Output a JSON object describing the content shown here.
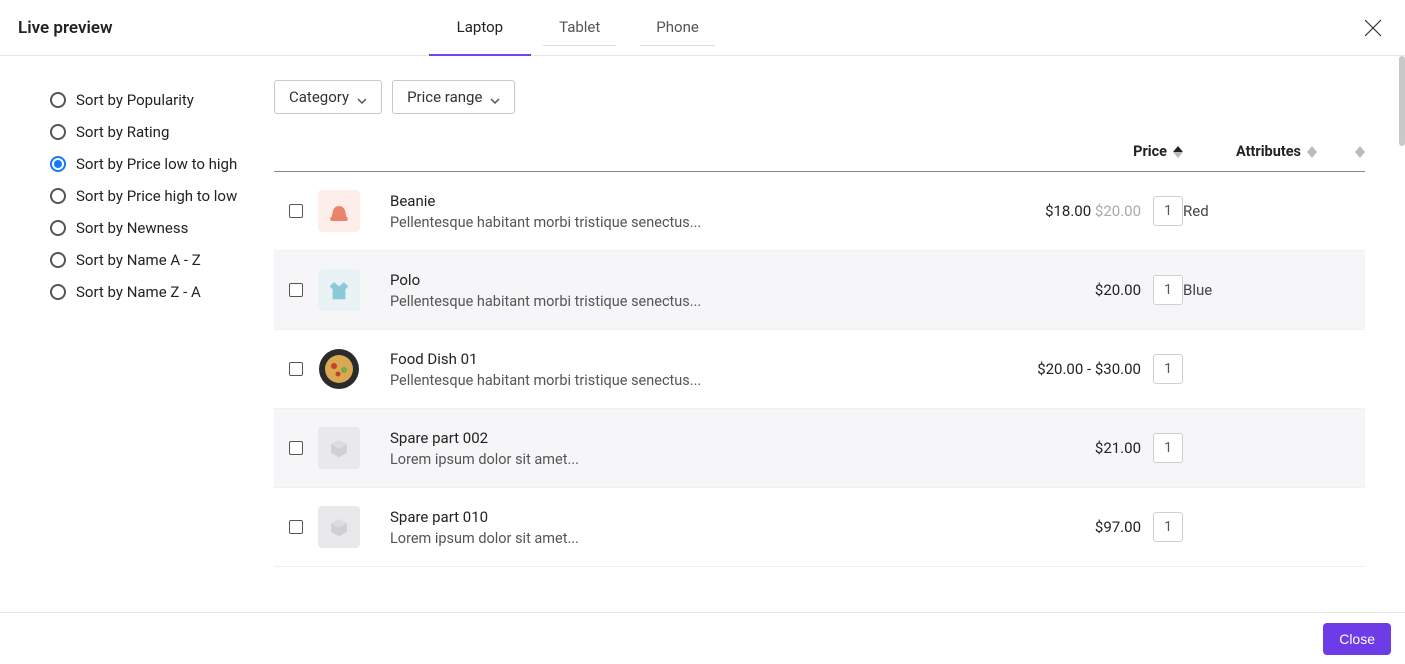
{
  "header": {
    "title": "Live preview",
    "tabs": [
      {
        "label": "Laptop",
        "active": true
      },
      {
        "label": "Tablet",
        "active": false
      },
      {
        "label": "Phone",
        "active": false
      }
    ]
  },
  "sort": {
    "options": [
      {
        "label": "Sort by Popularity",
        "selected": false
      },
      {
        "label": "Sort by Rating",
        "selected": false
      },
      {
        "label": "Sort by Price low to high",
        "selected": true
      },
      {
        "label": "Sort by Price high to low",
        "selected": false
      },
      {
        "label": "Sort by Newness",
        "selected": false
      },
      {
        "label": "Sort by Name A - Z",
        "selected": false
      },
      {
        "label": "Sort by Name Z - A",
        "selected": false
      }
    ]
  },
  "filters": {
    "category": "Category",
    "price_range": "Price range"
  },
  "columns": {
    "price": "Price",
    "attributes": "Attributes",
    "price_sort_dir": "asc"
  },
  "rows": [
    {
      "name": "Beanie",
      "desc": "Pellentesque habitant morbi tristique senectus...",
      "price": "$18.00",
      "old_price": "$20.00",
      "qty": "1",
      "attr": "Red",
      "thumb": "beanie",
      "alt": false
    },
    {
      "name": "Polo",
      "desc": "Pellentesque habitant morbi tristique senectus...",
      "price": "$20.00",
      "old_price": "",
      "qty": "1",
      "attr": "Blue",
      "thumb": "polo",
      "alt": true
    },
    {
      "name": "Food Dish 01",
      "desc": "Pellentesque habitant morbi tristique senectus...",
      "price": "$20.00 - $30.00",
      "old_price": "",
      "qty": "1",
      "attr": "",
      "thumb": "dish",
      "alt": false
    },
    {
      "name": "Spare part 002",
      "desc": "Lorem ipsum dolor sit amet...",
      "price": "$21.00",
      "old_price": "",
      "qty": "1",
      "attr": "",
      "thumb": "grey",
      "alt": true
    },
    {
      "name": "Spare part 010",
      "desc": "Lorem ipsum dolor sit amet...",
      "price": "$97.00",
      "old_price": "",
      "qty": "1",
      "attr": "",
      "thumb": "grey",
      "alt": false
    }
  ],
  "footer": {
    "close": "Close"
  }
}
